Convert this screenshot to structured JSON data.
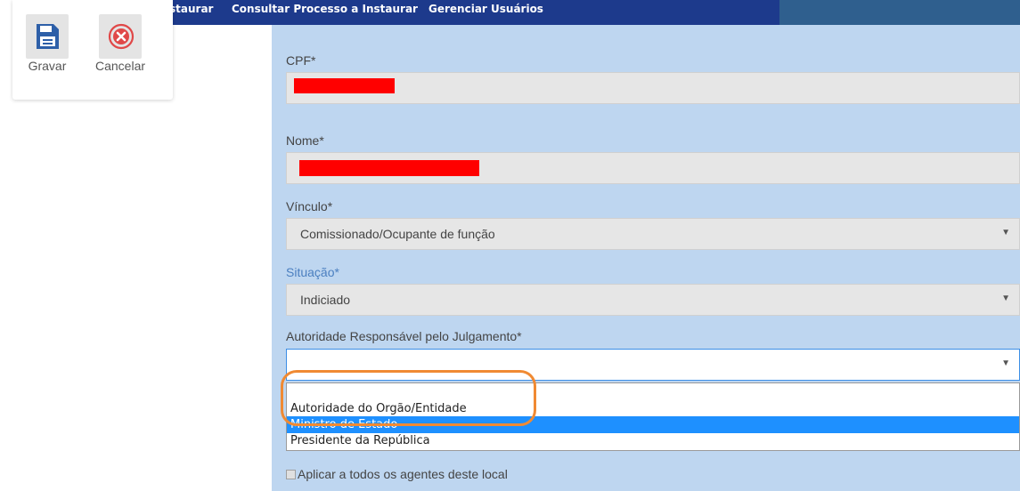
{
  "topnav": {
    "items": [
      "staurar",
      "Consultar Processo a Instaurar",
      "Gerenciar Usuários"
    ]
  },
  "toolbar": {
    "save_label": "Gravar",
    "cancel_label": "Cancelar"
  },
  "form": {
    "cpf_label": "CPF*",
    "nome_label": "Nome*",
    "vinculo_label": "Vínculo*",
    "vinculo_value": "Comissionado/Ocupante de função",
    "situacao_label": "Situação*",
    "situacao_value": "Indiciado",
    "autoridade_label": "Autoridade Responsável pelo Julgamento*",
    "autoridade_value": "",
    "autoridade_options": [
      "Autoridade do Orgão/Entidade",
      "Ministro de Estado",
      "Presidente da República"
    ],
    "apply_all_label": "Aplicar a todos os agentes deste local",
    "apply_all_checked": false
  },
  "icons": {
    "save": "floppy-disk-icon",
    "cancel": "close-circle-icon",
    "dropdown": "triangle-down-icon"
  },
  "colors": {
    "nav_bg": "#1d3a8c",
    "panel_bg": "#bed6f0",
    "selected_option": "#1e90ff",
    "annotation_ring": "#f08a33",
    "redaction": "#ff0000"
  }
}
